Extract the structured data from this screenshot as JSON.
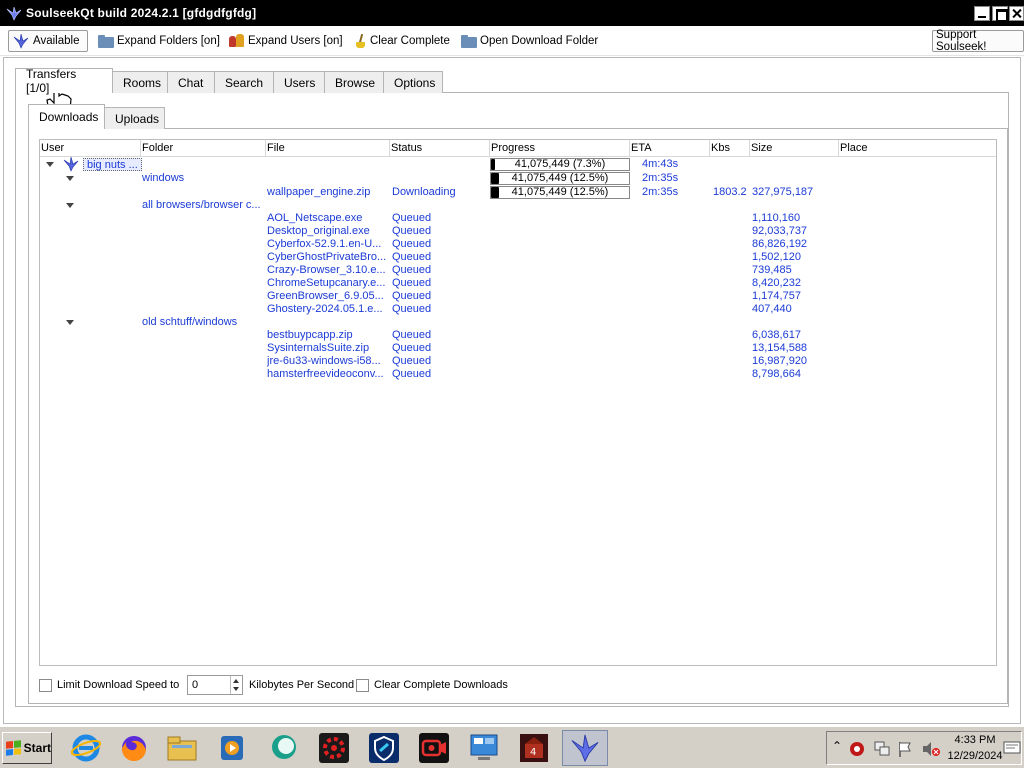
{
  "window": {
    "title": "SoulseekQt build 2024.2.1 [gfdgdfgfdg]"
  },
  "toolbar": {
    "status": "Available",
    "expand_folders": "Expand Folders [on]",
    "expand_users": "Expand Users [on]",
    "clear_complete": "Clear Complete",
    "open_download_folder": "Open Download Folder",
    "support": "Support Soulseek!"
  },
  "tabs": [
    "Transfers [1/0]",
    "Rooms",
    "Chat",
    "Search",
    "Users",
    "Browse",
    "Options"
  ],
  "subtabs": [
    "Downloads",
    "Uploads"
  ],
  "columns": [
    "User",
    "Folder",
    "File",
    "Status",
    "Progress",
    "ETA",
    "Kbs",
    "Size",
    "Place"
  ],
  "transfers": {
    "user": "big nuts ...",
    "user_progress": {
      "text": "41,075,449 (7.3%)",
      "fraction": 0.073
    },
    "user_eta": "4m:43s",
    "folders": [
      {
        "name": "windows",
        "progress": {
          "text": "41,075,449 (12.5%)",
          "fraction": 0.125
        },
        "eta": "2m:35s",
        "files": [
          {
            "file": "wallpaper_engine.zip",
            "status": "Downloading",
            "progress": {
              "text": "41,075,449 (12.5%)",
              "fraction": 0.125
            },
            "eta": "2m:35s",
            "kbs": "1803.2",
            "size": "327,975,187"
          }
        ]
      },
      {
        "name": "all browsers/browser c...",
        "files": [
          {
            "file": "AOL_Netscape.exe",
            "status": "Queued",
            "size": "1,110,160"
          },
          {
            "file": "Desktop_original.exe",
            "status": "Queued",
            "size": "92,033,737"
          },
          {
            "file": "Cyberfox-52.9.1.en-U...",
            "status": "Queued",
            "size": "86,826,192"
          },
          {
            "file": "CyberGhostPrivateBro...",
            "status": "Queued",
            "size": "1,502,120"
          },
          {
            "file": "Crazy-Browser_3.10.e...",
            "status": "Queued",
            "size": "739,485"
          },
          {
            "file": "ChromeSetupcanary.e...",
            "status": "Queued",
            "size": "8,420,232"
          },
          {
            "file": "GreenBrowser_6.9.05...",
            "status": "Queued",
            "size": "1,174,757"
          },
          {
            "file": "Ghostery-2024.05.1.e...",
            "status": "Queued",
            "size": "407,440"
          }
        ]
      },
      {
        "name": "old schtuff/windows",
        "files": [
          {
            "file": "bestbuypcapp.zip",
            "status": "Queued",
            "size": "6,038,617"
          },
          {
            "file": "SysinternalsSuite.zip",
            "status": "Queued",
            "size": "13,154,588"
          },
          {
            "file": "jre-6u33-windows-i58...",
            "status": "Queued",
            "size": "16,987,920"
          },
          {
            "file": "hamsterfreevideoconv...",
            "status": "Queued",
            "size": "8,798,664"
          }
        ]
      }
    ]
  },
  "bottom": {
    "limit_label": "Limit Download Speed to",
    "limit_value": "0",
    "units": "Kilobytes Per Second",
    "clear_complete_downloads": "Clear Complete Downloads"
  },
  "taskbar": {
    "start": "Start",
    "apps": [
      "internet-explorer-icon",
      "firefox-icon",
      "file-explorer-icon",
      "media-player-icon",
      "chat-bubble-icon",
      "settings-gear-icon",
      "shield-icon",
      "screen-recorder-icon",
      "system-monitor-icon",
      "game-app-icon",
      "soulseek-icon"
    ],
    "time": "4:33 PM",
    "date": "12/29/2024"
  },
  "colors": {
    "link_blue": "#1b3bd6",
    "titlebar": "#000000",
    "taskbar": "#d4d0c8"
  }
}
